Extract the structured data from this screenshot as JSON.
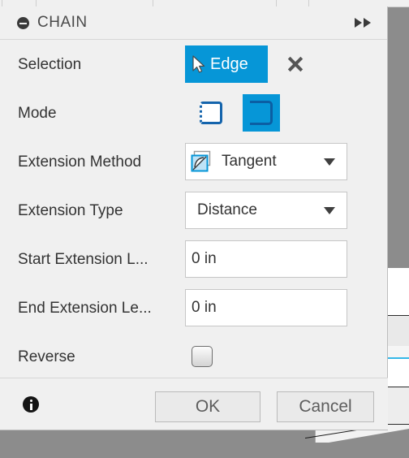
{
  "app": {
    "accent_blue": "#0696D7",
    "panel_bg": "#F0F0F0",
    "viewport_bg": "#8C8C8C"
  },
  "titlebar": {
    "collapse_icon": "collapse-circle-minus-icon",
    "title": "CHAIN",
    "expand_icon": "double-chevron-right-icon"
  },
  "rows": {
    "selection": {
      "label": "Selection",
      "button_label": "Edge",
      "button_icon": "cursor-arrow-icon",
      "clear_icon": "close-x-icon"
    },
    "mode": {
      "label": "Mode",
      "options": [
        {
          "name": "open-chain-mode",
          "selected": false
        },
        {
          "name": "closed-chain-mode",
          "selected": true
        }
      ]
    },
    "extension_method": {
      "label": "Extension Method",
      "value": "Tangent",
      "icon": "tangent-icon",
      "caret": "chevron-down-icon"
    },
    "extension_type": {
      "label": "Extension Type",
      "value": "Distance",
      "caret": "chevron-down-icon"
    },
    "start_extension": {
      "label": "Start Extension L...",
      "value": "0 in"
    },
    "end_extension": {
      "label": "End Extension Le...",
      "value": "0 in"
    },
    "reverse": {
      "label": "Reverse",
      "checked": false
    }
  },
  "footer": {
    "info_icon": "info-circle-icon",
    "ok_label": "OK",
    "cancel_label": "Cancel"
  }
}
